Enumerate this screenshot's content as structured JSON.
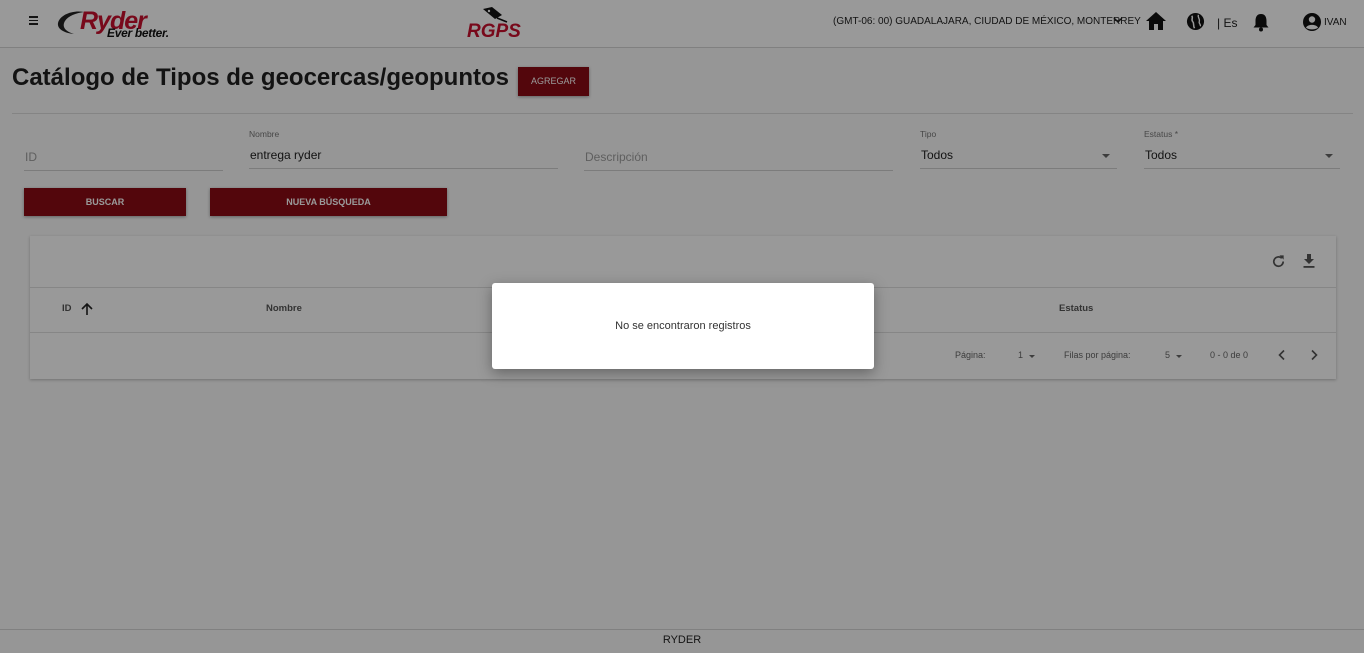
{
  "header": {
    "brand": "Ryder",
    "brand_tagline": "Ever better.",
    "product": "RGPS",
    "timezone": "(GMT-06: 00) GUADALAJARA, CIUDAD DE MÉXICO, MONTERREY",
    "language": "| Es",
    "user": "IVAN",
    "icons": [
      "menu-icon",
      "chevron-down-icon",
      "home-icon",
      "globe-icon",
      "bell-icon",
      "account-circle-icon"
    ]
  },
  "page": {
    "title": "Catálogo de Tipos de geocercas/geopuntos",
    "add_label": "AGREGAR"
  },
  "filters": {
    "id": {
      "placeholder": "ID",
      "value": ""
    },
    "nombre": {
      "label": "Nombre",
      "value": "entrega ryder"
    },
    "descripcion": {
      "placeholder": "Descripción",
      "value": ""
    },
    "tipo": {
      "label": "Tipo",
      "value": "Todos"
    },
    "estatus": {
      "label": "Estatus *",
      "value": "Todos"
    }
  },
  "actions": {
    "search_label": "BUSCAR",
    "new_search_label": "NUEVA BÚSQUEDA"
  },
  "table": {
    "columns": [
      "ID",
      "Nombre",
      "Estatus"
    ],
    "rows": [],
    "pagination": {
      "page_label": "Página:",
      "page": "1",
      "rows_label": "Filas por página:",
      "rows_per_page": "5",
      "range": "0 - 0 de 0"
    }
  },
  "dialog": {
    "message": "No se encontraron registros"
  },
  "footer": {
    "text": "RYDER"
  },
  "colors": {
    "brand_red": "#c8102e",
    "button_red": "#8b0a14"
  }
}
